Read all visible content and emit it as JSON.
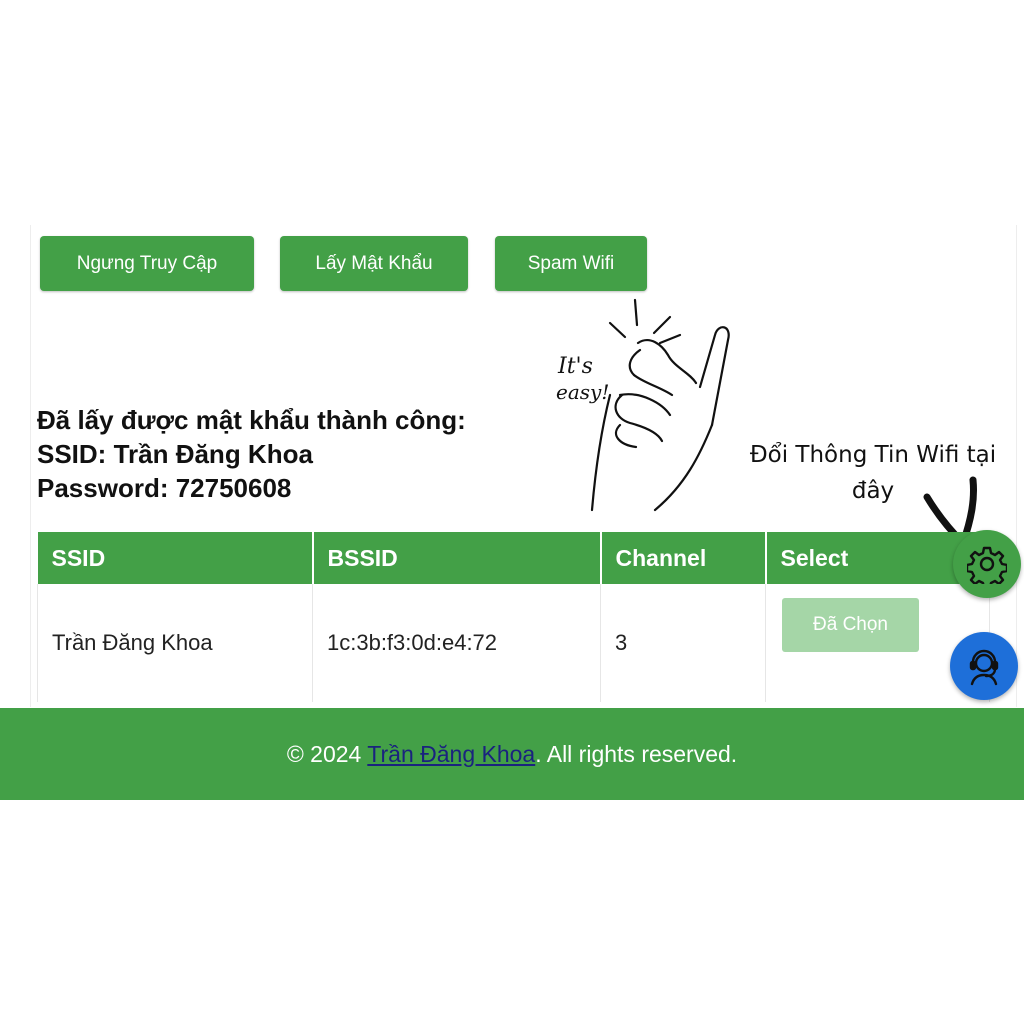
{
  "toolbar": {
    "stop_access_label": "Ngưng Truy Cập",
    "get_password_label": "Lấy Mật Khẩu",
    "spam_wifi_label": "Spam Wifi"
  },
  "result": {
    "line1": "Đã lấy được mật khẩu thành công:",
    "line2": "SSID: Trần Đăng Khoa",
    "line3": "Password: 72750608"
  },
  "table": {
    "headers": [
      "SSID",
      "BSSID",
      "Channel",
      "Select"
    ],
    "rows": [
      {
        "ssid": "Trần Đăng Khoa",
        "bssid": "1c:3b:f3:0d:e4:72",
        "channel": "3",
        "select_label": "Đã Chọn"
      }
    ]
  },
  "footer": {
    "prefix": "© 2024 ",
    "author_link": "Trần Đăng Khoa",
    "suffix": ". All rights reserved."
  },
  "annotation": {
    "sticker_line1": "It's",
    "sticker_line2": "easy!",
    "note_line1": "Đổi Thông Tin Wifi tại",
    "note_line2": "đây"
  },
  "icons": {
    "settings": "gear-icon",
    "support": "headset-agent-icon"
  },
  "colors": {
    "primary_green": "#43a047",
    "light_green": "#a5d6a7",
    "support_blue": "#1e6fd9",
    "link_navy": "#1a237e"
  }
}
